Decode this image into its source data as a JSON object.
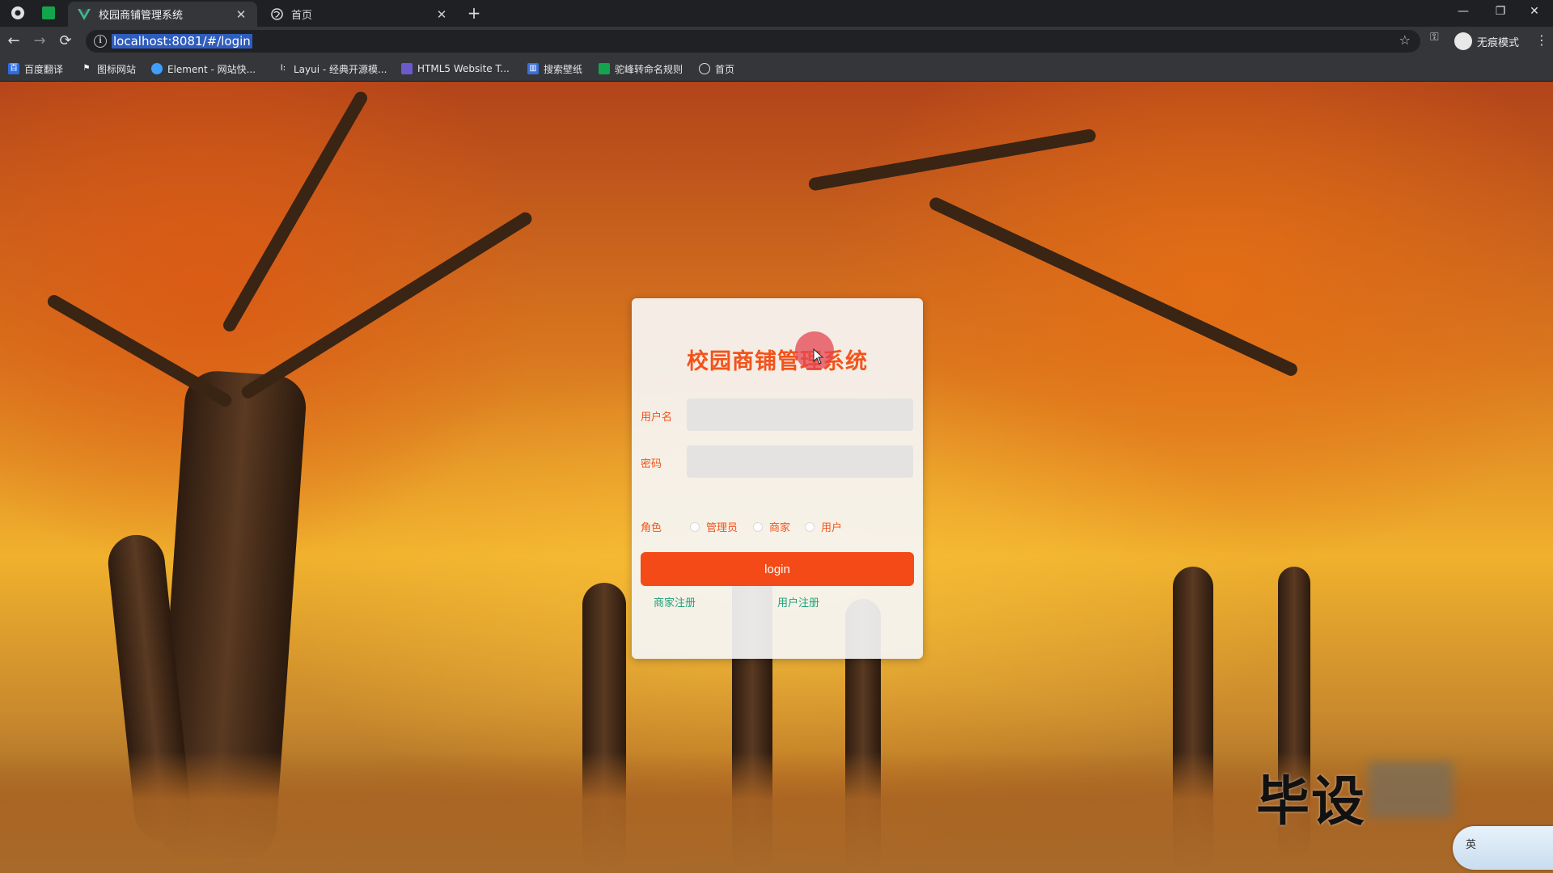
{
  "browser": {
    "tabs": [
      {
        "title": "校园商铺管理系统",
        "active": true
      },
      {
        "title": "首页",
        "active": false
      }
    ],
    "url": "localhost:8081/#/login",
    "profile_label": "无痕模式",
    "bookmarks": [
      {
        "label": "百度翻译",
        "icon": "baidu-translate-icon",
        "color": "#2b6de5"
      },
      {
        "label": "图标网站",
        "icon": "flag-icon",
        "color": "#222222"
      },
      {
        "label": "Element - 网站快...",
        "icon": "element-icon",
        "color": "#409eff"
      },
      {
        "label": "Layui - 经典开源模...",
        "icon": "layui-icon",
        "color": "#333333"
      },
      {
        "label": "HTML5 Website T...",
        "icon": "html5-template-icon",
        "color": "#6a5acd"
      },
      {
        "label": "搜索壁纸",
        "icon": "wallpaper-icon",
        "color": "#3a6fd8"
      },
      {
        "label": "驼峰转命名规则",
        "icon": "camel-case-icon",
        "color": "#14a44d"
      },
      {
        "label": "首页",
        "icon": "globe-icon",
        "color": "#dddddd"
      }
    ]
  },
  "login": {
    "title": "校园商铺管理系统",
    "username_label": "用户名",
    "username_value": "",
    "password_label": "密码",
    "password_value": "",
    "role_label": "角色",
    "roles": [
      "管理员",
      "商家",
      "用户"
    ],
    "login_button": "login",
    "register_links": [
      "商家注册",
      "用户注册"
    ]
  },
  "watermark": "毕设",
  "ime_indicator": "英",
  "colors": {
    "accent": "#f3531a",
    "button": "#f44a17",
    "link": "#1ea07a"
  }
}
